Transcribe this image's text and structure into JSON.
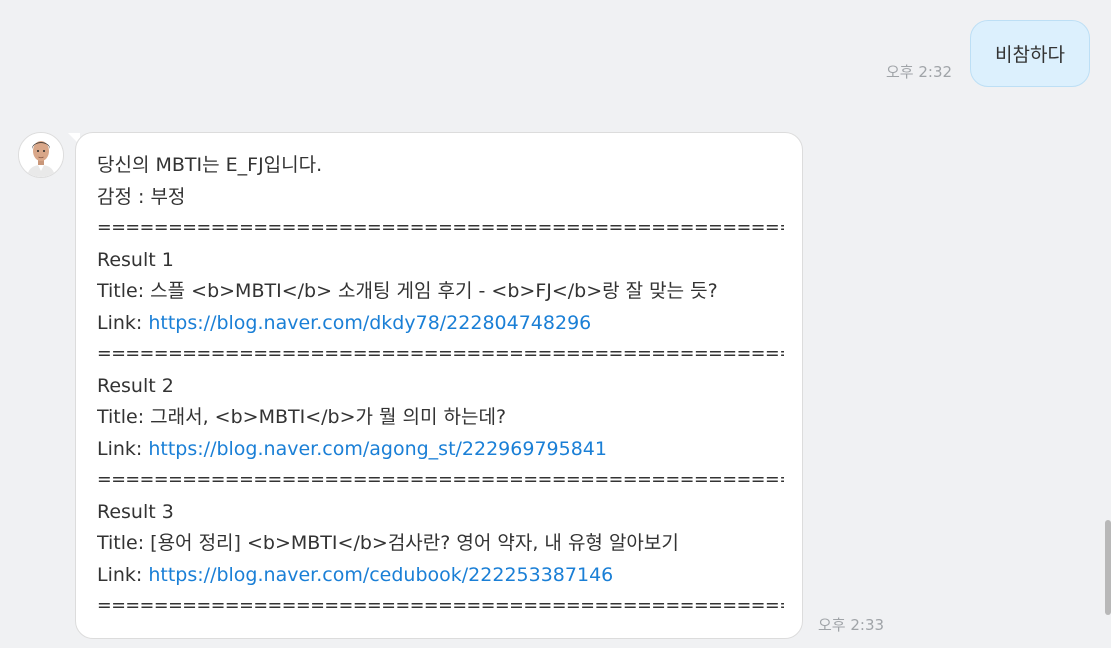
{
  "messages": {
    "user": {
      "text": "비참하다",
      "time": "오후 2:32"
    },
    "bot": {
      "time": "오후 2:33",
      "intro": "당신의 MBTI는 E_FJ입니다.",
      "emotion": "감정 : 부정",
      "separator": "======================================================",
      "results": [
        {
          "heading": "Result 1",
          "title": "Title: 스플 <b>MBTI</b> 소개팅 게임 후기 - <b>FJ</b>랑 잘 맞는 듯?",
          "link_prefix": "Link: ",
          "link_url": "https://blog.naver.com/dkdy78/222804748296"
        },
        {
          "heading": "Result 2",
          "title": "Title: 그래서, <b>MBTI</b>가 뭘 의미 하는데?",
          "link_prefix": "Link: ",
          "link_url": "https://blog.naver.com/agong_st/222969795841"
        },
        {
          "heading": "Result 3",
          "title": "Title: [용어 정리] <b>MBTI</b>검사란? 영어 약자, 내 유형 알아보기",
          "link_prefix": "Link: ",
          "link_url": "https://blog.naver.com/cedubook/222253387146"
        }
      ]
    }
  }
}
